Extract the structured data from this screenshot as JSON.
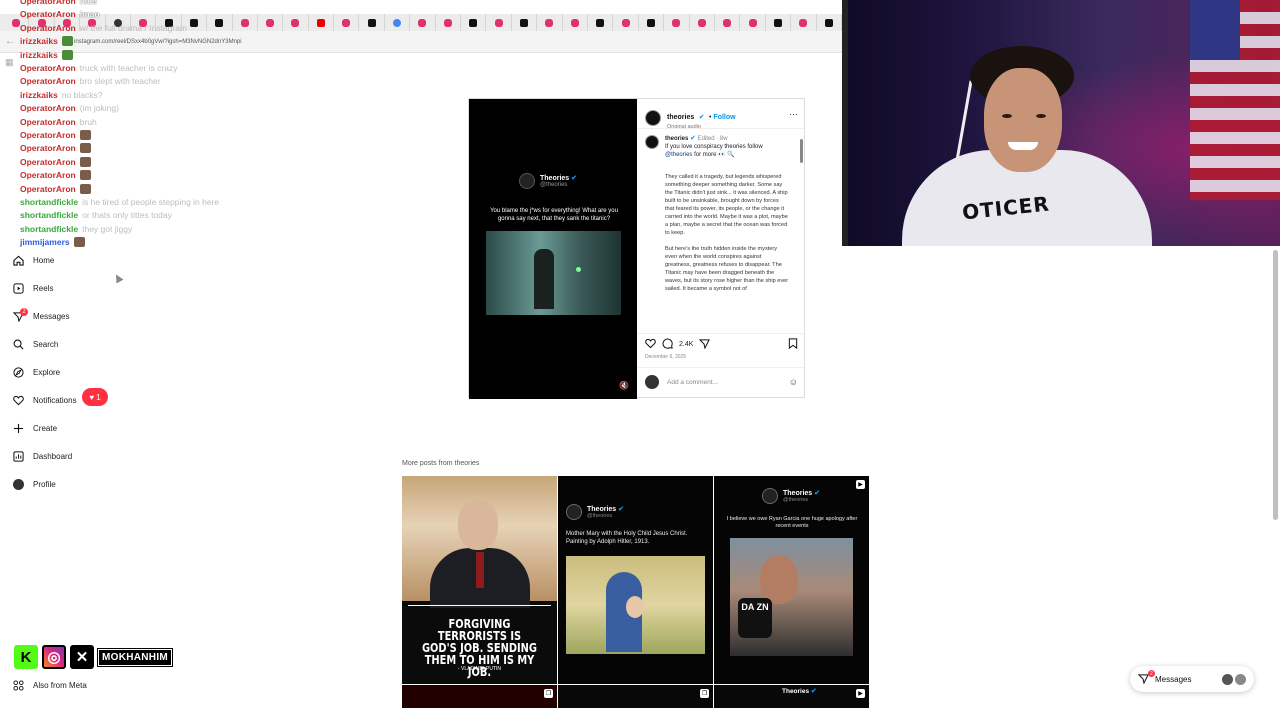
{
  "browser": {
    "url": "instagram.com/reel/DSxx4b0gVw/?igsh=M3NvNGN2dnY3Mnpi",
    "tabs": [
      "ig",
      "ig",
      "ig",
      "ig",
      "gh",
      "ig",
      "x",
      "x",
      "x",
      "ig",
      "ig",
      "ig",
      "yt",
      "ig",
      "x",
      "g",
      "ig",
      "ig",
      "x",
      "ig",
      "x",
      "ig",
      "ig",
      "x",
      "ig",
      "x",
      "ig",
      "ig",
      "ig",
      "ig",
      "x",
      "ig",
      "x"
    ]
  },
  "chat": [
    {
      "user": "OperatorAron",
      "msg": "nice",
      "color": "red",
      "msg_style": "white"
    },
    {
      "user": "OperatorAron",
      "msg": "lmao",
      "color": "red",
      "msg_style": "white"
    },
    {
      "user": "OperatorAron",
      "msg": "w/ the full drama / Instagram",
      "color": "red"
    },
    {
      "user": "irizzkaiks",
      "msg": "",
      "color": "red",
      "emote": "frog"
    },
    {
      "user": "irizzkaiks",
      "msg": "",
      "color": "red",
      "emote": "frog"
    },
    {
      "user": "OperatorAron",
      "msg": "truck with teacher is crazy",
      "color": "red"
    },
    {
      "user": "OperatorAron",
      "msg": "bro slept with teacher",
      "color": "red"
    },
    {
      "user": "irizzkaiks",
      "msg": "no blacks?",
      "color": "red"
    },
    {
      "user": "OperatorAron",
      "msg": "(im joking)",
      "color": "red"
    },
    {
      "user": "OperatorAron",
      "msg": "bruh",
      "color": "red"
    },
    {
      "user": "OperatorAron",
      "msg": "",
      "color": "red",
      "emote": "face"
    },
    {
      "user": "OperatorAron",
      "msg": "",
      "color": "red",
      "emote": "face"
    },
    {
      "user": "OperatorAron",
      "msg": "",
      "color": "red",
      "emote": "face"
    },
    {
      "user": "OperatorAron",
      "msg": "",
      "color": "red",
      "emote": "face"
    },
    {
      "user": "OperatorAron",
      "msg": "",
      "color": "red",
      "emote": "face"
    },
    {
      "user": "shortandfickle",
      "msg": "is he tired of people stepping in here",
      "color": "green"
    },
    {
      "user": "shortandfickle",
      "msg": "or thats only tittes today",
      "color": "green"
    },
    {
      "user": "shortandfickle",
      "msg": "they got jiggy",
      "color": "green"
    },
    {
      "user": "jimmijamers",
      "msg": "",
      "color": "blue",
      "emote": "face"
    }
  ],
  "sidebar": {
    "items": [
      {
        "label": "Home",
        "icon": "home-icon"
      },
      {
        "label": "Reels",
        "icon": "reels-icon"
      },
      {
        "label": "Messages",
        "icon": "messages-icon",
        "badge": "2"
      },
      {
        "label": "Search",
        "icon": "search-icon"
      },
      {
        "label": "Explore",
        "icon": "explore-icon"
      },
      {
        "label": "Notifications",
        "icon": "heart-icon"
      },
      {
        "label": "Create",
        "icon": "plus-icon"
      },
      {
        "label": "Dashboard",
        "icon": "dashboard-icon"
      },
      {
        "label": "Profile",
        "icon": "profile-icon"
      }
    ],
    "notification_count": "1",
    "also_from_meta": "Also from Meta"
  },
  "socials": {
    "handle": "MOKHANHIM"
  },
  "post": {
    "video": {
      "brand": "Theories",
      "handle": "@theories",
      "caption": "You blame the j*ws for everything! What are you gonna say next, that they sank the titanic?"
    },
    "author": "theories",
    "follow": "Follow",
    "audio": "Original audio",
    "caption_user": "theories",
    "edited": "Edited · 8w",
    "caption_intro": "If you love conspiracy theories follow",
    "caption_link": "@theories",
    "caption_tail": "for more 👀 🔍",
    "body": "They called it a tragedy, but legends whispered something deeper something darker. Some say the Titanic didn't just sink... it was silenced. A ship built to be unsinkable, brought down by forces that feared its power, its people, or the change it carried into the world. Maybe it was a plot, maybe a plan, maybe a secret that the ocean was forced to keep.\n\nBut here's the truth hidden inside the mystery even when the world conspires against greatness, greatness refuses to disappear. The Titanic may have been dragged beneath the waves, but its story rose higher than the ship ever sailed. It became a symbol not of",
    "comments_count": "2.4K",
    "date": "December 6, 2025",
    "add_comment_placeholder": "Add a comment..."
  },
  "more_posts": {
    "label": "More posts from theories",
    "posts": [
      {
        "text": "FORGIVING TERRORISTS IS GOD'S JOB. SENDING THEM TO HIM IS MY JOB.",
        "sign": "- VLADIMIR PUTIN"
      },
      {
        "name": "Theories",
        "handle": "@theories",
        "text": "Mother Mary with the Holy Child Jesus Christ. Painting by Adolph Hitler, 1913."
      },
      {
        "name": "Theories",
        "handle": "@theories",
        "text": "I believe we owe Ryan Garcia one huge apology after recent events",
        "mic": "DA ZN"
      },
      {
        "name": "Theories"
      }
    ]
  },
  "webcam": {
    "hoodie_text": "OTICER"
  },
  "messages_pill": {
    "label": "Messages",
    "badge": "2"
  }
}
